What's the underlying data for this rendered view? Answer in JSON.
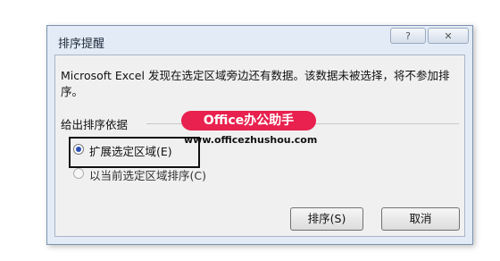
{
  "dialog": {
    "title": "排序提醒",
    "help_label": "?",
    "close_label": "✕",
    "message": "Microsoft Excel 发现在选定区域旁边还有数据。该数据未被选择，将不参加排序。",
    "group_label": "给出排序依据",
    "options": [
      {
        "label": "扩展选定区域(E)",
        "checked": true
      },
      {
        "label": "以当前选定区域排序(C)",
        "checked": false
      }
    ],
    "sort_button": "排序(S)",
    "cancel_button": "取消"
  },
  "watermark": {
    "brand": "Office办公助手",
    "url": "www.officezhushou.com",
    "brand_color": "#e8214e"
  }
}
